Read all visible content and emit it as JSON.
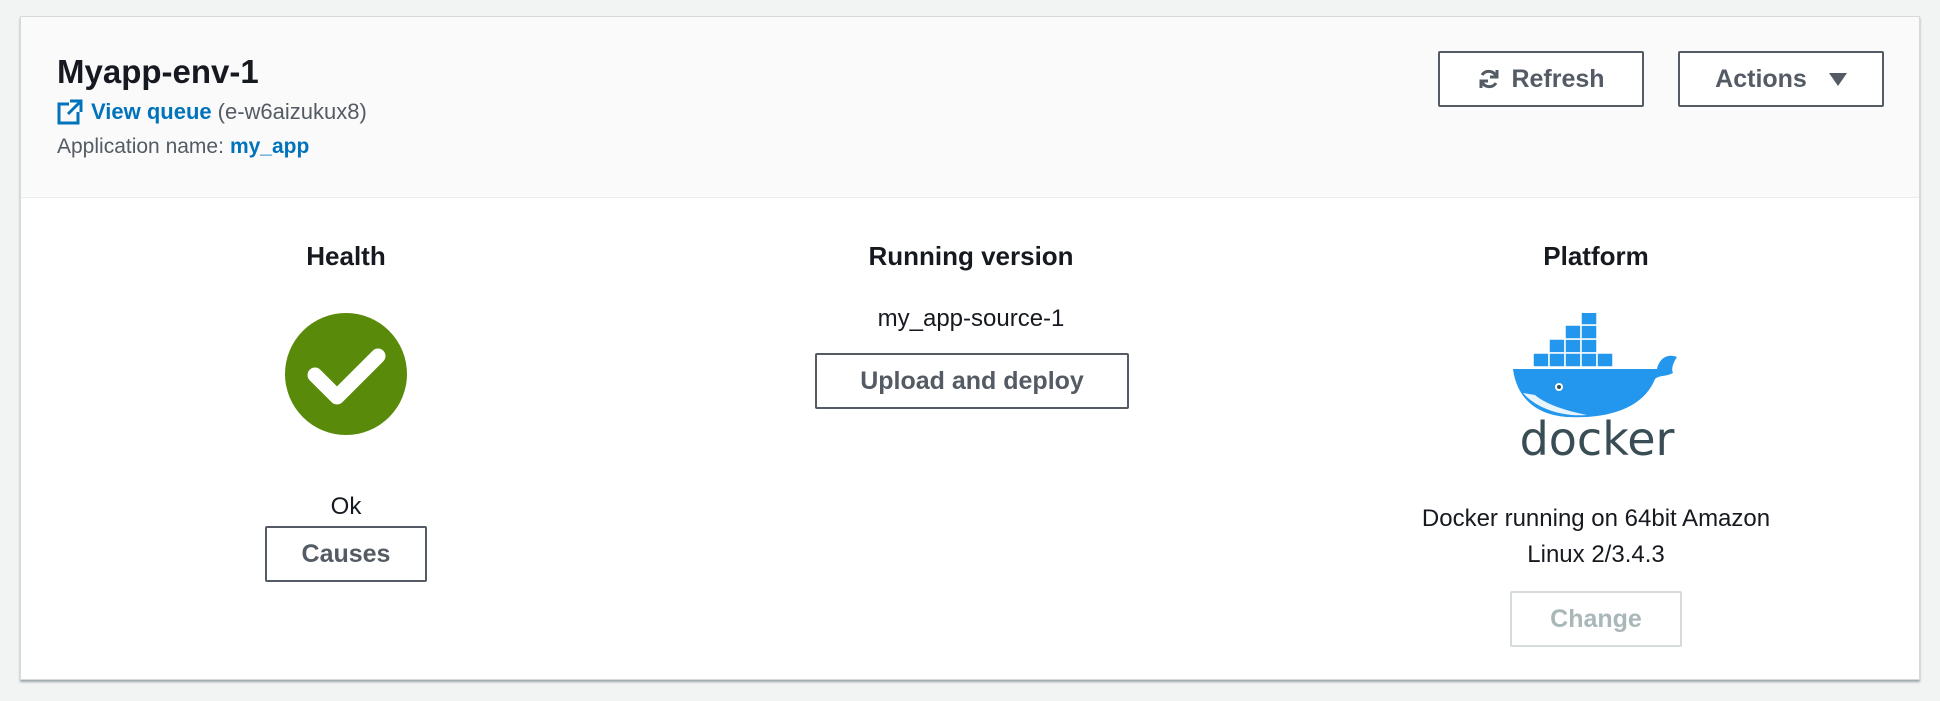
{
  "environment": {
    "name": "Myapp-env-1",
    "view_queue_label": "View queue",
    "env_id": "(e-w6aizukux8)",
    "app_name_label": "Application name:",
    "app_name": "my_app"
  },
  "toolbar": {
    "refresh_label": "Refresh",
    "actions_label": "Actions"
  },
  "health": {
    "title": "Health",
    "status": "Ok",
    "status_color": "#5a8a0a",
    "causes_label": "Causes"
  },
  "running_version": {
    "title": "Running version",
    "version": "my_app-source-1",
    "upload_label": "Upload and deploy"
  },
  "platform": {
    "title": "Platform",
    "logo_text": "docker",
    "description_line1": "Docker running on 64bit Amazon",
    "description_line2": "Linux 2/3.4.3",
    "change_label": "Change"
  },
  "colors": {
    "link": "#0073bb",
    "docker_blue": "#2396ed",
    "docker_text": "#394d54"
  }
}
